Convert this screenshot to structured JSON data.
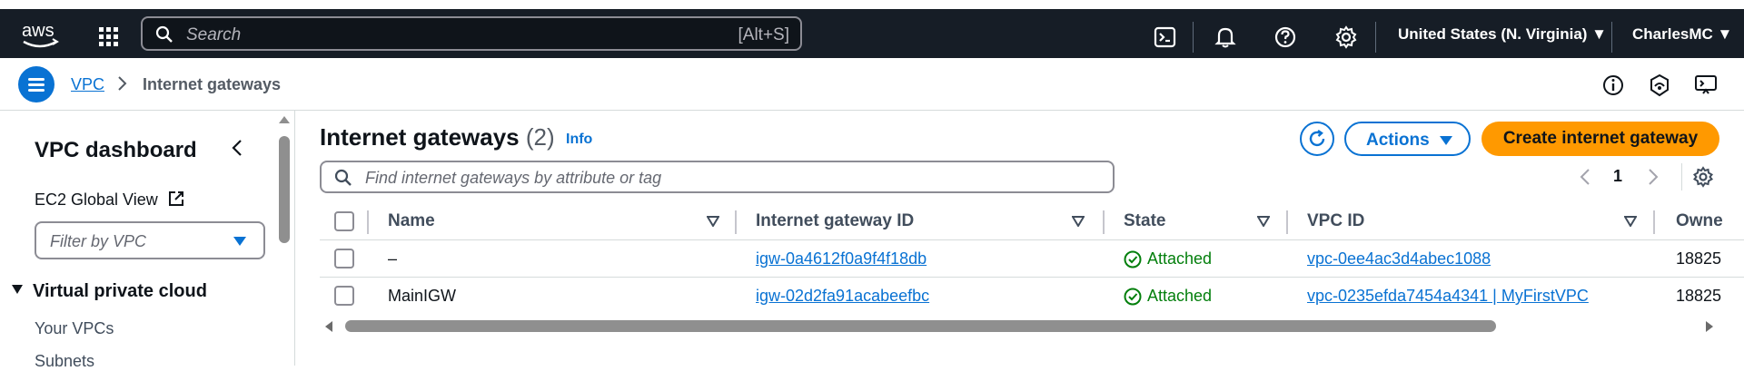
{
  "topnav": {
    "logo_text": "aws",
    "search_placeholder": "Search",
    "search_shortcut": "[Alt+S]",
    "region": "United States (N. Virginia) ▼",
    "account": "CharlesMC ▼"
  },
  "breadcrumb": {
    "service": "VPC",
    "current": "Internet gateways"
  },
  "sidebar": {
    "title": "VPC dashboard",
    "global_view": "EC2 Global View",
    "filter_placeholder": "Filter by VPC",
    "section": "Virtual private cloud",
    "items": [
      "Your VPCs",
      "Subnets"
    ]
  },
  "main": {
    "title": "Internet gateways",
    "count": "(2)",
    "info": "Info",
    "actions_label": "Actions",
    "create_label": "Create internet gateway",
    "search_placeholder": "Find internet gateways by attribute or tag",
    "page": "1"
  },
  "table": {
    "columns": [
      "Name",
      "Internet gateway ID",
      "State",
      "VPC ID",
      "Owne"
    ],
    "rows": [
      {
        "name": "–",
        "id": "igw-0a4612f0a9f4f18db",
        "state": "Attached",
        "vpc": "vpc-0ee4ac3d4abec1088",
        "owner": "18825"
      },
      {
        "name": "MainIGW",
        "id": "igw-02d2fa91acabeefbc",
        "state": "Attached",
        "vpc": "vpc-0235efda7454a4341 | MyFirstVPC",
        "owner": "18825"
      }
    ]
  },
  "colors": {
    "nav_bg": "#161d26",
    "link": "#0972d3",
    "primary_button": "#ff9900",
    "success": "#037f0c"
  },
  "icons": [
    "aws-logo",
    "apps-grid-icon",
    "search-icon",
    "cloudshell-icon",
    "bell-icon",
    "help-icon",
    "gear-icon",
    "menu-icon",
    "chevron-right-icon",
    "info-icon",
    "notifications-icon",
    "feedback-icon",
    "chevron-left-icon",
    "external-link-icon",
    "caret-down-icon",
    "refresh-icon",
    "sort-icon",
    "check-circle-icon"
  ]
}
